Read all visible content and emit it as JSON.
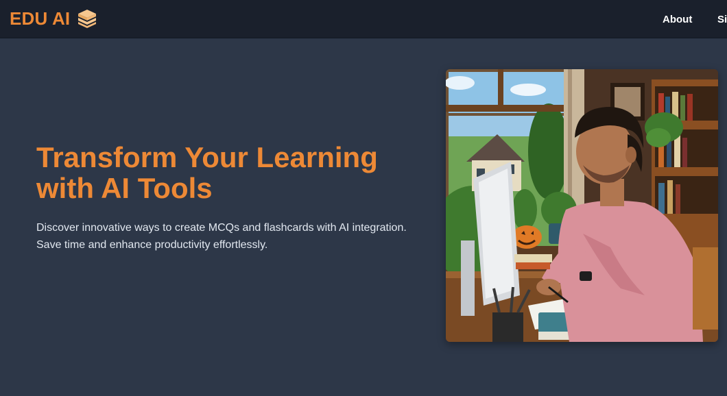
{
  "header": {
    "brand": "EDU AI",
    "brand_icon": "stacked-layers-icon",
    "nav": [
      {
        "label": "About"
      },
      {
        "label": "Si"
      }
    ]
  },
  "hero": {
    "title_line1": "Transform Your Learning",
    "title_line2": "with AI Tools",
    "desc_line1": "Discover innovative ways to create MCQs and flashcards with AI integration.",
    "desc_line2": "Save time and enhance productivity effortlessly."
  },
  "colors": {
    "accent": "#ed8936",
    "header_bg": "#1a202c",
    "page_bg": "#2d3748",
    "text": "#e2e8f0"
  }
}
